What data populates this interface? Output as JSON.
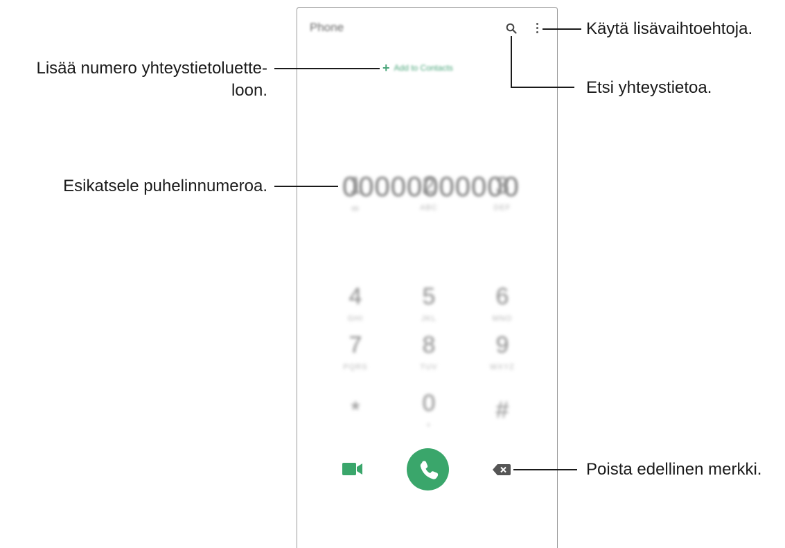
{
  "app": {
    "title": "Phone",
    "add_to_contacts": "Add to Contacts",
    "entered_number": "00000000000"
  },
  "keypad": [
    {
      "digit": "1",
      "letters": "ꝏ"
    },
    {
      "digit": "2",
      "letters": "ABC"
    },
    {
      "digit": "3",
      "letters": "DEF"
    },
    {
      "digit": "4",
      "letters": "GHI"
    },
    {
      "digit": "5",
      "letters": "JKL"
    },
    {
      "digit": "6",
      "letters": "MNO"
    },
    {
      "digit": "7",
      "letters": "PQRS"
    },
    {
      "digit": "8",
      "letters": "TUV"
    },
    {
      "digit": "9",
      "letters": "WXYZ"
    },
    {
      "digit": "*",
      "letters": ""
    },
    {
      "digit": "0",
      "letters": "+"
    },
    {
      "digit": "#",
      "letters": ""
    }
  ],
  "callouts": {
    "more_options": "Käytä lisävaihtoehtoja.",
    "add_number_line1": "Lisää numero yhteystietoluette-",
    "add_number_line2": "loon.",
    "search_contact": "Etsi yhteystietoa.",
    "preview_number": "Esikatsele puhelinnumeroa.",
    "delete_char": "Poista edellinen merkki."
  },
  "colors": {
    "accent_green": "#3aa66b",
    "add_contacts_green": "#4aa57a"
  },
  "icons": [
    "search-icon",
    "more-options-icon",
    "video-call-icon",
    "phone-icon",
    "backspace-icon",
    "plus-icon"
  ]
}
